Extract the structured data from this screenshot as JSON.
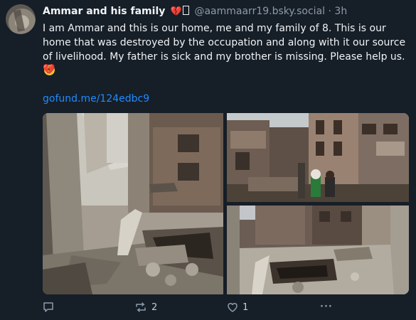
{
  "post": {
    "author": "Ammar and his family",
    "author_emoji_heart": "💔",
    "handle": "@aammaarr19.bsky.social",
    "separator": "·",
    "time": "3h",
    "text": "I am Ammar and this is our home, me and my family of 8. This is our home that was destroyed by the occupation and along with it our source of livelihood. My father is sick and my brother is missing. Please help us.",
    "trailing_heart": "💔",
    "link": "gofund.me/124edbc9"
  },
  "actions": {
    "reply": {
      "icon": "reply-icon",
      "count": ""
    },
    "repost": {
      "icon": "repost-icon",
      "count": "2"
    },
    "like": {
      "icon": "heart-outline-icon",
      "count": "1"
    },
    "more": {
      "icon": "more-horizontal-icon",
      "label": "···"
    }
  },
  "colors": {
    "background": "#161e27",
    "text": "#f1f3f5",
    "muted": "#8c9bab",
    "link": "#208bfe",
    "heart": "#d5203c"
  }
}
